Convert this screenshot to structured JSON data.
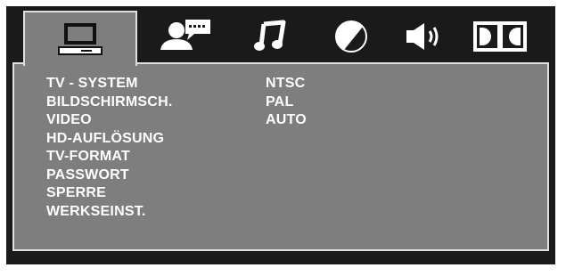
{
  "tabs": [
    {
      "name": "tv-icon",
      "active": true
    },
    {
      "name": "user-speech-icon",
      "active": false
    },
    {
      "name": "music-note-icon",
      "active": false
    },
    {
      "name": "brightness-icon",
      "active": false
    },
    {
      "name": "speaker-icon",
      "active": false
    },
    {
      "name": "dolby-icon",
      "active": false
    }
  ],
  "menu": {
    "items": [
      "TV - SYSTEM",
      "BILDSCHIRMSCH.",
      "VIDEO",
      "HD-AUFLÖSUNG",
      "TV-FORMAT",
      "PASSWORT",
      "SPERRE",
      "WERKSEINST."
    ],
    "options": [
      "NTSC",
      "PAL",
      "AUTO"
    ]
  },
  "colors": {
    "background": "#1a1a1a",
    "panel": "#7e7e7e",
    "border": "#e0e0e0",
    "text": "#ffffff"
  }
}
